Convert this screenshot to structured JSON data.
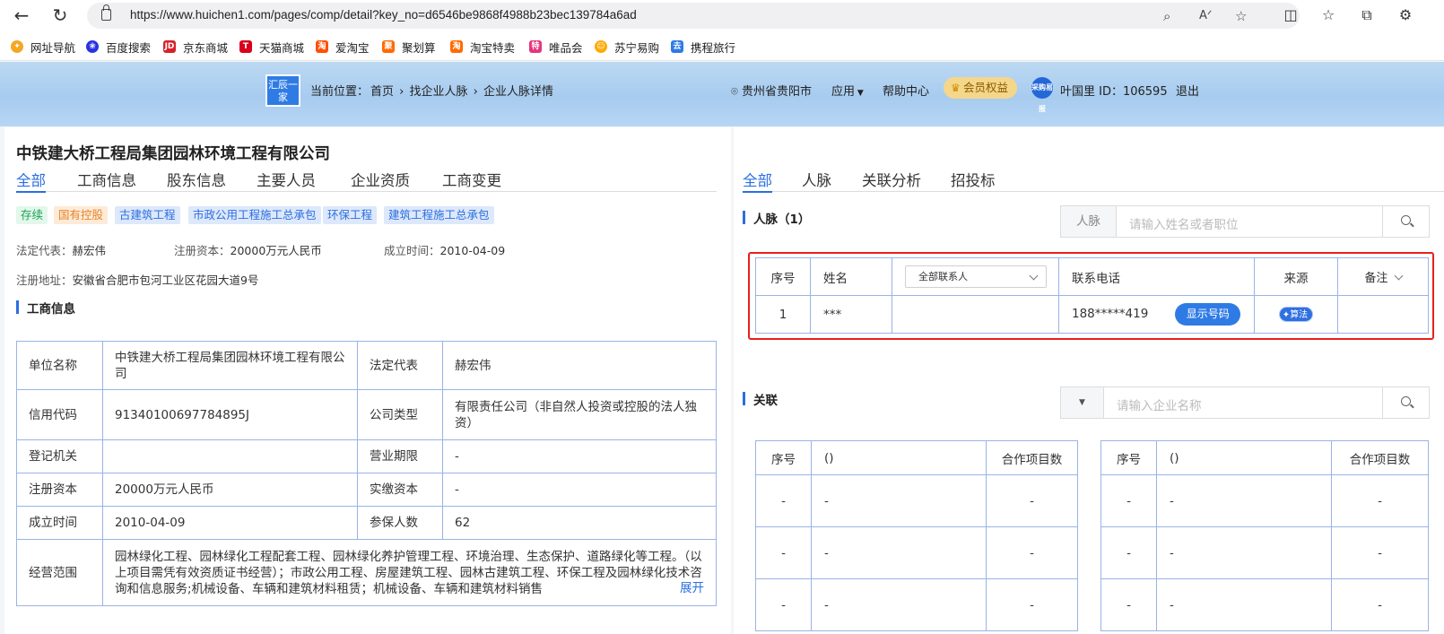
{
  "browser": {
    "url": "https://www.huichen1.com/pages/comp/detail?key_no=d6546be9868f4988b23bec139784a6ad",
    "bookmarks": [
      {
        "label": "网址导航",
        "color": "#f5a623",
        "icon": "globe-bookmark-icon"
      },
      {
        "label": "百度搜索",
        "color": "#2932e1",
        "icon": "paw-bookmark-icon"
      },
      {
        "label": "京东商城",
        "color": "#d7212a",
        "icon": "jd-bookmark-icon"
      },
      {
        "label": "天猫商城",
        "color": "#d9001b",
        "icon": "tmall-bookmark-icon"
      },
      {
        "label": "爱淘宝",
        "color": "#ff5000",
        "icon": "taobao-bookmark-icon"
      },
      {
        "label": "聚划算",
        "color": "#ff6a00",
        "icon": "juhuasuan-bookmark-icon"
      },
      {
        "label": "淘宝特卖",
        "color": "#ff6a00",
        "icon": "taobao-sale-bookmark-icon"
      },
      {
        "label": "唯品会",
        "color": "#e5337c",
        "icon": "vip-bookmark-icon"
      },
      {
        "label": "苏宁易购",
        "color": "#ffaa00",
        "icon": "suning-bookmark-icon"
      },
      {
        "label": "携程旅行",
        "color": "#2d7ae8",
        "icon": "ctrip-bookmark-icon"
      }
    ]
  },
  "header": {
    "logo_text": "汇辰一家",
    "breadcrumb_prefix": "当前位置：",
    "breadcrumb": [
      "首页",
      "找企业人脉",
      "企业人脉详情"
    ],
    "location": "贵州省贵阳市",
    "apps": "应用",
    "help": "帮助中心",
    "vip": "会员权益",
    "avatar_text": "采购易报",
    "user": "叶国里 ID：106595",
    "logout": "退出"
  },
  "company": {
    "name": "中铁建大桥工程局集团园林环境工程有限公司",
    "tabs": [
      "全部",
      "工商信息",
      "股东信息",
      "主要人员",
      "企业资质",
      "工商变更"
    ],
    "tags": [
      {
        "label": "存续",
        "style": "green"
      },
      {
        "label": "国有控股",
        "style": "orange"
      },
      {
        "label": "古建筑工程",
        "style": "blue"
      },
      {
        "label": "市政公用工程施工总承包",
        "style": "blue"
      },
      {
        "label": "环保工程",
        "style": "blue"
      },
      {
        "label": "建筑工程施工总承包",
        "style": "blue"
      }
    ],
    "legal_rep_label": "法定代表：",
    "legal_rep": "赫宏伟",
    "reg_capital_label": "注册资本：",
    "reg_capital": "20000万元人民币",
    "established_label": "成立时间：",
    "established": "2010-04-09",
    "address_label": "注册地址：",
    "address": "安徽省合肥市包河工业区花园大道9号"
  },
  "business_info": {
    "title": "工商信息",
    "rows": [
      {
        "l1": "单位名称",
        "v1": "中铁建大桥工程局集团园林环境工程有限公司",
        "l2": "法定代表",
        "v2": "赫宏伟"
      },
      {
        "l1": "信用代码",
        "v1": "91340100697784895J",
        "l2": "公司类型",
        "v2": "有限责任公司（非自然人投资或控股的法人独资）"
      },
      {
        "l1": "登记机关",
        "v1": "",
        "l2": "营业期限",
        "v2": "-"
      },
      {
        "l1": "注册资本",
        "v1": "20000万元人民币",
        "l2": "实缴资本",
        "v2": "-"
      },
      {
        "l1": "成立时间",
        "v1": "2010-04-09",
        "l2": "参保人数",
        "v2": "62"
      }
    ],
    "scope_label": "经营范围",
    "scope": "园林绿化工程、园林绿化工程配套工程、园林绿化养护管理工程、环境治理、生态保护、道路绿化等工程。（以上项目需凭有效资质证书经营）；市政公用工程、房屋建筑工程、园林古建筑工程、环保工程及园林绿化技术咨询和信息服务;机械设备、车辆和建筑材料租赁；机械设备、车辆和建筑材料销售",
    "expand": "展开"
  },
  "right": {
    "tabs": [
      "全部",
      "人脉",
      "关联分析",
      "招投标"
    ],
    "contacts": {
      "title": "人脉（1）",
      "search_prefix": "人脉",
      "search_placeholder": "请输入姓名或者职位",
      "headers": {
        "index": "序号",
        "name": "姓名",
        "filter": "全部联系人",
        "phone": "联系电话",
        "source": "来源",
        "note": "备注"
      },
      "rows": [
        {
          "index": "1",
          "name": "***",
          "phone": "188*****419",
          "show_btn": "显示号码",
          "source": "算法"
        }
      ]
    },
    "relations": {
      "title": "关联",
      "search_placeholder": "请输入企业名称",
      "headers": {
        "index": "序号",
        "name": "()",
        "count": "合作项目数"
      },
      "rows": [
        {
          "index": "-",
          "name": "-",
          "count": "-"
        },
        {
          "index": "-",
          "name": "-",
          "count": "-"
        },
        {
          "index": "-",
          "name": "-",
          "count": "-"
        }
      ]
    }
  }
}
